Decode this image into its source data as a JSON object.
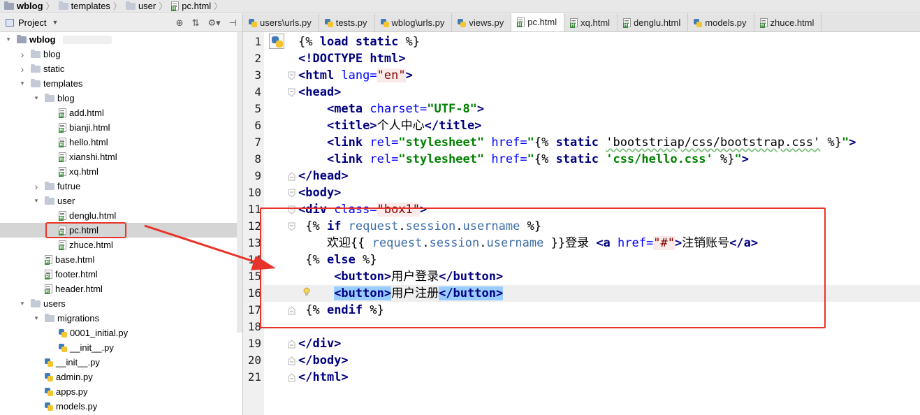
{
  "breadcrumb": [
    {
      "label": "wblog",
      "bold": true,
      "icon": "folder-dark-icon"
    },
    {
      "label": "templates",
      "icon": "folder-icon"
    },
    {
      "label": "user",
      "icon": "folder-icon"
    },
    {
      "label": "pc.html",
      "icon": "html-file-icon"
    }
  ],
  "project": {
    "title": "Project",
    "tools": [
      "target-icon",
      "collapse-icon",
      "gear-icon",
      "hide-icon"
    ]
  },
  "tree": [
    {
      "label": "wblog",
      "depth": 0,
      "exp": "open",
      "icon": "folder-dark",
      "bold": true
    },
    {
      "label": "blog",
      "depth": 1,
      "exp": "closed",
      "icon": "folder"
    },
    {
      "label": "static",
      "depth": 1,
      "exp": "closed",
      "icon": "folder"
    },
    {
      "label": "templates",
      "depth": 1,
      "exp": "open",
      "icon": "folder"
    },
    {
      "label": "blog",
      "depth": 2,
      "exp": "open",
      "icon": "folder"
    },
    {
      "label": "add.html",
      "depth": 3,
      "exp": "none",
      "icon": "html"
    },
    {
      "label": "bianji.html",
      "depth": 3,
      "exp": "none",
      "icon": "html"
    },
    {
      "label": "hello.html",
      "depth": 3,
      "exp": "none",
      "icon": "html"
    },
    {
      "label": "xianshi.html",
      "depth": 3,
      "exp": "none",
      "icon": "html"
    },
    {
      "label": "xq.html",
      "depth": 3,
      "exp": "none",
      "icon": "html"
    },
    {
      "label": "futrue",
      "depth": 2,
      "exp": "closed",
      "icon": "folder"
    },
    {
      "label": "user",
      "depth": 2,
      "exp": "open",
      "icon": "folder"
    },
    {
      "label": "denglu.html",
      "depth": 3,
      "exp": "none",
      "icon": "html"
    },
    {
      "label": "pc.html",
      "depth": 3,
      "exp": "none",
      "icon": "html",
      "selected": true
    },
    {
      "label": "zhuce.html",
      "depth": 3,
      "exp": "none",
      "icon": "html"
    },
    {
      "label": "base.html",
      "depth": 2,
      "exp": "none",
      "icon": "html"
    },
    {
      "label": "footer.html",
      "depth": 2,
      "exp": "none",
      "icon": "html"
    },
    {
      "label": "header.html",
      "depth": 2,
      "exp": "none",
      "icon": "html"
    },
    {
      "label": "users",
      "depth": 1,
      "exp": "open",
      "icon": "folder"
    },
    {
      "label": "migrations",
      "depth": 2,
      "exp": "open",
      "icon": "folder"
    },
    {
      "label": "0001_initial.py",
      "depth": 3,
      "exp": "none",
      "icon": "py"
    },
    {
      "label": "__init__.py",
      "depth": 3,
      "exp": "none",
      "icon": "py"
    },
    {
      "label": "__init__.py",
      "depth": 2,
      "exp": "none",
      "icon": "py"
    },
    {
      "label": "admin.py",
      "depth": 2,
      "exp": "none",
      "icon": "py"
    },
    {
      "label": "apps.py",
      "depth": 2,
      "exp": "none",
      "icon": "py"
    },
    {
      "label": "models.py",
      "depth": 2,
      "exp": "none",
      "icon": "py"
    }
  ],
  "tabs": [
    {
      "label": "users\\urls.py",
      "icon": "py",
      "active": false
    },
    {
      "label": "tests.py",
      "icon": "py",
      "active": false
    },
    {
      "label": "wblog\\urls.py",
      "icon": "py",
      "active": false
    },
    {
      "label": "views.py",
      "icon": "py",
      "active": false
    },
    {
      "label": "pc.html",
      "icon": "html",
      "active": true
    },
    {
      "label": "xq.html",
      "icon": "html",
      "active": false
    },
    {
      "label": "denglu.html",
      "icon": "html",
      "active": false
    },
    {
      "label": "models.py",
      "icon": "py",
      "active": false
    },
    {
      "label": "zhuce.html",
      "icon": "html",
      "active": false
    }
  ],
  "editor": {
    "current_line": 16,
    "lines": [
      {
        "n": "1",
        "fold": "",
        "tokens": [
          [
            "dt",
            "{% "
          ],
          [
            "k",
            "load static"
          ],
          [
            "dt",
            " %}"
          ]
        ]
      },
      {
        "n": "2",
        "fold": "",
        "tokens": [
          [
            "t",
            "<!DOCTYPE "
          ],
          [
            "t",
            "html"
          ],
          [
            "t",
            ">"
          ]
        ]
      },
      {
        "n": "3",
        "fold": "open",
        "tokens": [
          [
            "t",
            "<html "
          ],
          [
            "a",
            "lang="
          ],
          [
            "v",
            "\"en\""
          ],
          [
            "t",
            ">"
          ]
        ]
      },
      {
        "n": "4",
        "fold": "open",
        "tokens": [
          [
            "t",
            "<head>"
          ]
        ]
      },
      {
        "n": "5",
        "fold": "",
        "tokens": [
          [
            "dt",
            "    "
          ],
          [
            "t",
            "<meta "
          ],
          [
            "a",
            "charset="
          ],
          [
            "s",
            "\"UTF-8\""
          ],
          [
            "t",
            ">"
          ]
        ]
      },
      {
        "n": "6",
        "fold": "",
        "tokens": [
          [
            "dt",
            "    "
          ],
          [
            "t",
            "<title>"
          ],
          [
            "dt",
            "个人中心"
          ],
          [
            "t",
            "</title>"
          ]
        ]
      },
      {
        "n": "7",
        "fold": "",
        "tokens": [
          [
            "dt",
            "    "
          ],
          [
            "t",
            "<link "
          ],
          [
            "a",
            "rel="
          ],
          [
            "s",
            "\"stylesheet\""
          ],
          [
            "dt",
            " "
          ],
          [
            "a",
            "href="
          ],
          [
            "s",
            "\""
          ],
          [
            "dt",
            "{% "
          ],
          [
            "k",
            "static "
          ],
          [
            "sq",
            "'bootstriap/css/bootstrap.css'"
          ],
          [
            "dt",
            " %}"
          ],
          [
            "s",
            "\""
          ],
          [
            "t",
            ">"
          ]
        ]
      },
      {
        "n": "8",
        "fold": "",
        "tokens": [
          [
            "dt",
            "    "
          ],
          [
            "t",
            "<link "
          ],
          [
            "a",
            "rel="
          ],
          [
            "s",
            "\"stylesheet\""
          ],
          [
            "dt",
            " "
          ],
          [
            "a",
            "href="
          ],
          [
            "s",
            "\""
          ],
          [
            "dt",
            "{% "
          ],
          [
            "k",
            "static "
          ],
          [
            "s",
            "'css/hello.css'"
          ],
          [
            "dt",
            " %}"
          ],
          [
            "s",
            "\""
          ],
          [
            "t",
            ">"
          ]
        ]
      },
      {
        "n": "9",
        "fold": "close",
        "tokens": [
          [
            "t",
            "</head>"
          ]
        ]
      },
      {
        "n": "10",
        "fold": "open",
        "tokens": [
          [
            "t",
            "<body>"
          ]
        ]
      },
      {
        "n": "11",
        "fold": "open",
        "tokens": [
          [
            "t",
            "<div "
          ],
          [
            "a",
            "class="
          ],
          [
            "v",
            "\"box1\""
          ],
          [
            "t",
            ">"
          ]
        ]
      },
      {
        "n": "12",
        "fold": "open",
        "tokens": [
          [
            "dt",
            " {% "
          ],
          [
            "k",
            "if "
          ],
          [
            "id",
            "request"
          ],
          [
            "dt",
            "."
          ],
          [
            "id",
            "session"
          ],
          [
            "dt",
            "."
          ],
          [
            "id",
            "username"
          ],
          [
            "dt",
            " %}"
          ]
        ]
      },
      {
        "n": "13",
        "fold": "",
        "tokens": [
          [
            "dt",
            "    欢迎{{ "
          ],
          [
            "id",
            "request"
          ],
          [
            "dt",
            "."
          ],
          [
            "id",
            "session"
          ],
          [
            "dt",
            "."
          ],
          [
            "id",
            "username"
          ],
          [
            "dt",
            " }}登录 "
          ],
          [
            "t",
            "<a "
          ],
          [
            "a",
            "href="
          ],
          [
            "v",
            "\"#\""
          ],
          [
            "t",
            ">"
          ],
          [
            "dt",
            "注销账号"
          ],
          [
            "t",
            "</a>"
          ]
        ]
      },
      {
        "n": "14",
        "fold": "",
        "tokens": [
          [
            "dt",
            " {% "
          ],
          [
            "k",
            "else"
          ],
          [
            "dt",
            " %}"
          ]
        ]
      },
      {
        "n": "15",
        "fold": "",
        "tokens": [
          [
            "dt",
            "     "
          ],
          [
            "t",
            "<button>"
          ],
          [
            "dt",
            "用户登录"
          ],
          [
            "t",
            "</button>"
          ]
        ]
      },
      {
        "n": "16",
        "fold": "",
        "tokens": [
          [
            "dt",
            "     "
          ],
          [
            "t hl",
            "<button>"
          ],
          [
            "dt",
            "用户注册"
          ],
          [
            "t hl",
            "</button>"
          ]
        ]
      },
      {
        "n": "17",
        "fold": "close",
        "tokens": [
          [
            "dt",
            " {% "
          ],
          [
            "k",
            "endif"
          ],
          [
            "dt",
            " %}"
          ]
        ]
      },
      {
        "n": "18",
        "fold": "",
        "tokens": []
      },
      {
        "n": "19",
        "fold": "close",
        "tokens": [
          [
            "t",
            "</div>"
          ]
        ]
      },
      {
        "n": "20",
        "fold": "close",
        "tokens": [
          [
            "t",
            "</body>"
          ]
        ]
      },
      {
        "n": "21",
        "fold": "close",
        "tokens": [
          [
            "t",
            "</html>"
          ]
        ]
      }
    ]
  },
  "annotation": {
    "color": "#e8332a"
  }
}
